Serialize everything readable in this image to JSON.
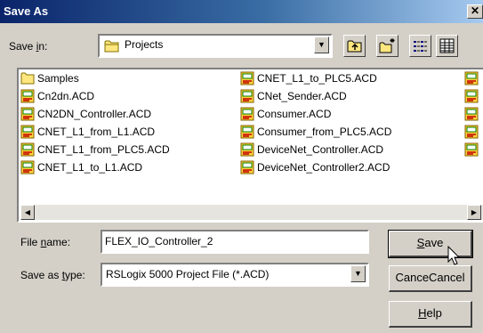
{
  "window": {
    "title": "Save As",
    "close_glyph": "✕"
  },
  "save_in": {
    "label": "Save in:",
    "value": "Projects",
    "toolbar_icons": [
      "up-one-level-icon",
      "create-new-folder-icon",
      "list-view-icon",
      "details-view-icon"
    ]
  },
  "files": {
    "column1": [
      {
        "name": "Samples",
        "icon": "folder-icon"
      },
      {
        "name": "Cn2dn.ACD",
        "icon": "acd-file-icon"
      },
      {
        "name": "CN2DN_Controller.ACD",
        "icon": "acd-file-icon"
      },
      {
        "name": "CNET_L1_from_L1.ACD",
        "icon": "acd-file-icon"
      },
      {
        "name": "CNET_L1_from_PLC5.ACD",
        "icon": "acd-file-icon"
      },
      {
        "name": "CNET_L1_to_L1.ACD",
        "icon": "acd-file-icon"
      }
    ],
    "column2": [
      {
        "name": "CNET_L1_to_PLC5.ACD",
        "icon": "acd-file-icon"
      },
      {
        "name": "CNet_Sender.ACD",
        "icon": "acd-file-icon"
      },
      {
        "name": "Consumer.ACD",
        "icon": "acd-file-icon"
      },
      {
        "name": "Consumer_from_PLC5.ACD",
        "icon": "acd-file-icon"
      },
      {
        "name": "DeviceNet_Controller.ACD",
        "icon": "acd-file-icon"
      },
      {
        "name": "DeviceNet_Controller2.ACD",
        "icon": "acd-file-icon"
      }
    ],
    "column3_partial_count": 5
  },
  "file_name": {
    "label": "File name:",
    "value": "FLEX_IO_Controller_2"
  },
  "save_as_type": {
    "label": "Save as type:",
    "value": "RSLogix 5000 Project File (*.ACD)"
  },
  "buttons": {
    "save": "Save",
    "cancel": "Cancel",
    "help": "Help"
  },
  "colors": {
    "title_active": "#0a246a",
    "face": "#d4d0c8"
  }
}
